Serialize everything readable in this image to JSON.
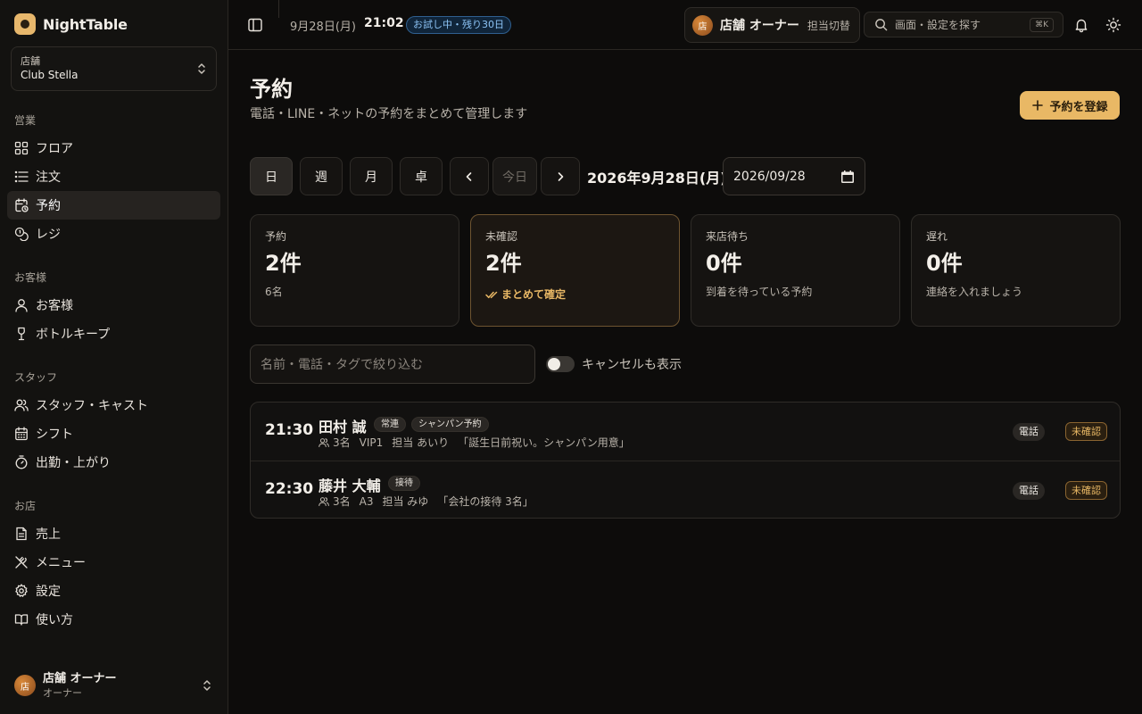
{
  "app": {
    "name": "NightTable"
  },
  "sidebar": {
    "store": {
      "label": "店舗",
      "name": "Club Stella"
    },
    "sections": [
      {
        "title": "営業",
        "items": [
          {
            "label": "フロア",
            "icon": "grid-icon"
          },
          {
            "label": "注文",
            "icon": "list-icon"
          },
          {
            "label": "予約",
            "icon": "calendar-clock-icon",
            "active": true
          },
          {
            "label": "レジ",
            "icon": "coins-icon"
          }
        ]
      },
      {
        "title": "お客様",
        "items": [
          {
            "label": "お客様",
            "icon": "user-icon"
          },
          {
            "label": "ボトルキープ",
            "icon": "wine-icon"
          }
        ]
      },
      {
        "title": "スタッフ",
        "items": [
          {
            "label": "スタッフ・キャスト",
            "icon": "users-icon"
          },
          {
            "label": "シフト",
            "icon": "calendar-icon"
          },
          {
            "label": "出勤・上がり",
            "icon": "timer-icon"
          }
        ]
      },
      {
        "title": "お店",
        "items": [
          {
            "label": "売上",
            "icon": "receipt-icon"
          },
          {
            "label": "メニュー",
            "icon": "utensils-icon"
          },
          {
            "label": "設定",
            "icon": "gear-icon"
          },
          {
            "label": "使い方",
            "icon": "book-icon"
          }
        ]
      }
    ],
    "account": {
      "avatar": "店",
      "name": "店舗 オーナー",
      "role": "オーナー"
    }
  },
  "topbar": {
    "date": "9月28日(月)",
    "time": "21:02",
    "trial_badge": "お試し中・残り30日",
    "owner": {
      "avatar": "店",
      "name": "店舗 オーナー",
      "switch_label": "担当切替"
    },
    "search": {
      "placeholder": "画面・設定を探す",
      "shortcut": "⌘K"
    }
  },
  "page": {
    "title": "予約",
    "subtitle": "電話・LINE・ネットの予約をまとめて管理します",
    "add_button": "予約を登録"
  },
  "toolbar": {
    "views": [
      "日",
      "週",
      "月",
      "卓"
    ],
    "active_view": "日",
    "today_label": "今日",
    "current_date": "2026年9月28日(月)",
    "date_input": "2026/09/28"
  },
  "stats": [
    {
      "label": "予約",
      "value": "2件",
      "sub": "6名"
    },
    {
      "label": "未確認",
      "value": "2件",
      "action": "まとめて確定",
      "highlight": true
    },
    {
      "label": "来店待ち",
      "value": "0件",
      "sub": "到着を待っている予約"
    },
    {
      "label": "遅れ",
      "value": "0件",
      "sub": "連絡を入れましょう"
    }
  ],
  "filter": {
    "placeholder": "名前・電話・タグで絞り込む",
    "show_cancelled_label": "キャンセルも表示",
    "show_cancelled": false
  },
  "reservations": [
    {
      "time": "21:30",
      "name": "田村 誠",
      "tags": [
        "常連",
        "シャンパン予約"
      ],
      "party": "3名",
      "table": "VIP1",
      "staff": "担当 あいり",
      "note": "「誕生日前祝い。シャンパン用意」",
      "channel": "電話",
      "status": "未確認"
    },
    {
      "time": "22:30",
      "name": "藤井 大輔",
      "tags": [
        "接待"
      ],
      "party": "3名",
      "table": "A3",
      "staff": "担当 みゆ",
      "note": "「会社の接待 3名」",
      "channel": "電話",
      "status": "未確認"
    }
  ],
  "colors": {
    "accent": "#e9b865",
    "background": "#0d0c0b",
    "trial_blue": "#8cc3f5"
  }
}
